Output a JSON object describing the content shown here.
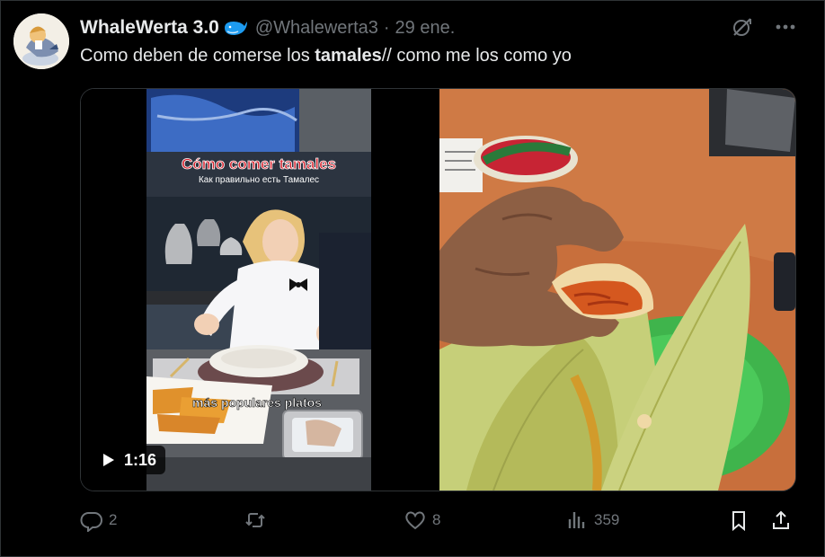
{
  "tweet": {
    "display_name": "WhaleWerta 3.0",
    "handle": "@Whalewerta3",
    "separator": "·",
    "date": "29 ene.",
    "text_before": "Como deben de comerse los ",
    "text_bold": "tamales",
    "text_after": "// como me los como yo"
  },
  "media": {
    "video": {
      "duration": "1:16",
      "overlay_title": "Cómo comer tamales",
      "overlay_subtitle": "Как правильно есть Тамалес",
      "caption": "más populares platos"
    }
  },
  "actions": {
    "replies": "2",
    "retweets": "",
    "likes": "8",
    "views": "359"
  },
  "colors": {
    "background": "#000000",
    "text": "#e7e9ea",
    "muted": "#71767b",
    "verified": "#1d9bf0"
  }
}
